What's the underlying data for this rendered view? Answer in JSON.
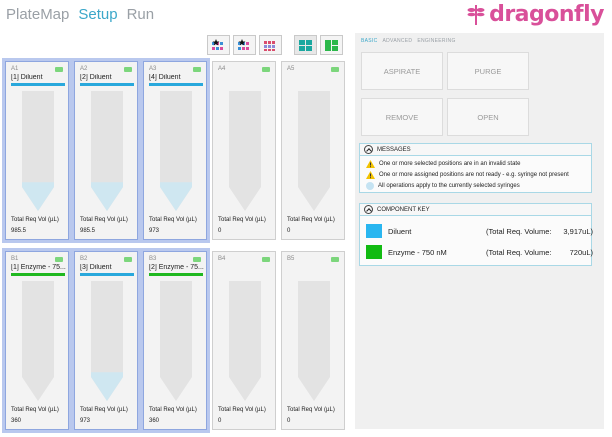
{
  "nav": {
    "items": [
      {
        "label": "PlateMap",
        "active": false
      },
      {
        "label": "Setup",
        "active": true
      },
      {
        "label": "Run",
        "active": false
      }
    ]
  },
  "logo": {
    "text": "dragonfly"
  },
  "view_buttons": [
    "star-grid-view-icon",
    "star-grid-view-alt-icon",
    "cross-grid-view-icon",
    "green-grid-2x2-icon",
    "green-grid-1x2-icon"
  ],
  "wells": [
    {
      "pos": "A1",
      "name": "[1] Diluent",
      "color": "#29a8dc",
      "vol_label": "Total Req Vol (µL)",
      "vol": "985.5",
      "fill": 0.24,
      "selected": true,
      "led": true
    },
    {
      "pos": "A2",
      "name": "[2] Diluent",
      "color": "#29a8dc",
      "vol_label": "Total Req Vol (µL)",
      "vol": "985.5",
      "fill": 0.24,
      "selected": true,
      "led": true
    },
    {
      "pos": "A3",
      "name": "[4] Diluent",
      "color": "#29a8dc",
      "vol_label": "Total Req Vol (µL)",
      "vol": "973",
      "fill": 0.24,
      "selected": true,
      "led": true
    },
    {
      "pos": "A4",
      "name": "",
      "color": "",
      "vol_label": "Total Req Vol (µL)",
      "vol": "0",
      "fill": 0,
      "selected": false,
      "led": true
    },
    {
      "pos": "A5",
      "name": "",
      "color": "",
      "vol_label": "Total Req Vol (µL)",
      "vol": "0",
      "fill": 0,
      "selected": false,
      "led": true
    },
    {
      "pos": "B1",
      "name": "[1] Enzyme - 75...",
      "color": "#1fb81f",
      "vol_label": "Total Req Vol (µL)",
      "vol": "360",
      "fill": 0,
      "selected": true,
      "led": true
    },
    {
      "pos": "B2",
      "name": "[3] Diluent",
      "color": "#29a8dc",
      "vol_label": "Total Req Vol (µL)",
      "vol": "973",
      "fill": 0.24,
      "selected": true,
      "led": true
    },
    {
      "pos": "B3",
      "name": "[2] Enzyme - 75...",
      "color": "#1fb81f",
      "vol_label": "Total Req Vol (µL)",
      "vol": "360",
      "fill": 0,
      "selected": true,
      "led": true
    },
    {
      "pos": "B4",
      "name": "",
      "color": "",
      "vol_label": "Total Req Vol (µL)",
      "vol": "0",
      "fill": 0,
      "selected": false,
      "led": true
    },
    {
      "pos": "B5",
      "name": "",
      "color": "",
      "vol_label": "Total Req Vol (µL)",
      "vol": "0",
      "fill": 0,
      "selected": false,
      "led": true
    }
  ],
  "panel": {
    "tabs": [
      {
        "label": "BASIC",
        "active": true
      },
      {
        "label": "ADVANCED",
        "active": false
      },
      {
        "label": "ENGINEERING",
        "active": false
      }
    ],
    "actions": {
      "aspirate": "ASPIRATE",
      "purge": "PURGE",
      "remove": "REMOVE",
      "open": "OPEN"
    },
    "messages": {
      "title": "MESSAGES",
      "items": [
        {
          "icon": "warning-icon",
          "text": "One or more selected positions are in an invalid state"
        },
        {
          "icon": "warning-icon",
          "text": "One or more assigned positions are not ready - e.g. syringe not present"
        },
        {
          "icon": "info-icon",
          "text": "All operations apply to the currently selected syringes"
        }
      ]
    },
    "component_key": {
      "title": "COMPONENT KEY",
      "items": [
        {
          "name": "Diluent",
          "label": "(Total Req. Volume:",
          "value": "3,917uL)",
          "color": "#29b6f0"
        },
        {
          "name": "Enzyme - 750 nM",
          "label": "(Total Req. Volume:",
          "value": "720uL)",
          "color": "#12bb12"
        }
      ]
    }
  }
}
